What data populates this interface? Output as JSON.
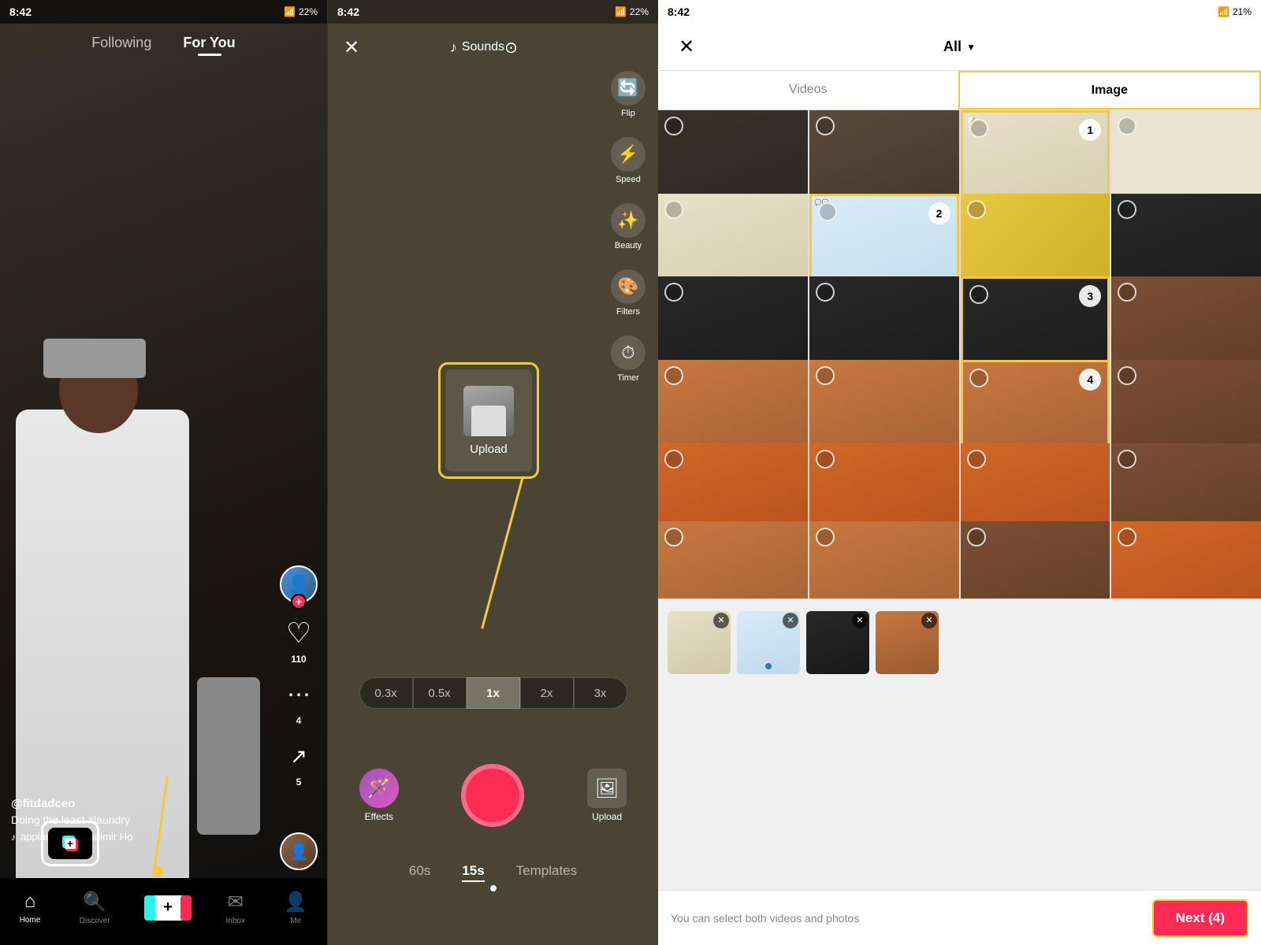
{
  "panels": {
    "feed": {
      "status_time": "8:42",
      "battery": "22%",
      "tabs": [
        "Following",
        "For You"
      ],
      "active_tab": "For You",
      "username": "@fitdadceo",
      "description": "Doing the least #laundry",
      "sound": "applause for Vladimir Ho",
      "likes": "110",
      "comments": "4",
      "shares": "5",
      "nav": {
        "items": [
          {
            "label": "Home",
            "icon": "🏠",
            "active": true
          },
          {
            "label": "Discover",
            "icon": "🔍",
            "active": false
          },
          {
            "label": "",
            "icon": "+",
            "active": false
          },
          {
            "label": "Inbox",
            "icon": "✉",
            "active": false
          },
          {
            "label": "Me",
            "icon": "👤",
            "active": false
          }
        ]
      }
    },
    "camera": {
      "status_time": "8:42",
      "battery": "22%",
      "sounds_label": "Sounds",
      "tools": [
        {
          "label": "Flip",
          "icon": "↻"
        },
        {
          "label": "Speed",
          "icon": "⏩"
        },
        {
          "label": "Beauty",
          "icon": "✨"
        },
        {
          "label": "Filters",
          "icon": "🎨"
        },
        {
          "label": "Timer",
          "icon": "⏱"
        }
      ],
      "upload_label": "Upload",
      "speed_options": [
        "0.3x",
        "0.5x",
        "1x",
        "2x",
        "3x"
      ],
      "active_speed": "1x",
      "effects_label": "Effects",
      "upload_label_bottom": "Upload",
      "timer_tabs": [
        "60s",
        "15s",
        "Templates"
      ],
      "active_timer": "15s"
    },
    "gallery": {
      "status_time": "8:42",
      "battery": "21%",
      "title": "All",
      "close_icon": "✕",
      "tabs": [
        "Videos",
        "Image"
      ],
      "active_tab": "Image",
      "selected_numbers": [
        1,
        2,
        3,
        4
      ],
      "hint_text": "You can select both videos and photos",
      "next_button": "Next (4)",
      "cells": [
        {
          "type": "person-dark",
          "selected": false,
          "number": null
        },
        {
          "type": "person-2",
          "selected": false,
          "number": null
        },
        {
          "type": "notes",
          "selected": true,
          "number": 1
        },
        {
          "type": "bright",
          "selected": false,
          "number": null
        },
        {
          "type": "notes-2",
          "selected": false,
          "number": null
        },
        {
          "type": "chat",
          "selected": true,
          "number": 2
        },
        {
          "type": "colorful",
          "selected": false,
          "number": null
        },
        {
          "type": "phone-1",
          "selected": true,
          "number": 3
        },
        {
          "type": "phone-2",
          "selected": false,
          "number": null
        },
        {
          "type": "beard-4",
          "selected": true,
          "number": 4
        },
        {
          "type": "shelf-1",
          "selected": false,
          "number": null
        },
        {
          "type": "beard-1",
          "selected": false,
          "number": null
        },
        {
          "type": "beard-2",
          "selected": false,
          "number": null
        },
        {
          "type": "beard-3",
          "selected": false,
          "number": null
        },
        {
          "type": "shelf-2",
          "selected": false,
          "number": null
        },
        {
          "type": "orange-1",
          "selected": false,
          "number": null
        },
        {
          "type": "beard-5",
          "selected": false,
          "number": null
        },
        {
          "type": "beard-6",
          "selected": false,
          "number": null
        },
        {
          "type": "shelf-3",
          "selected": false,
          "number": null
        },
        {
          "type": "orange-2",
          "selected": false,
          "number": null
        }
      ],
      "selected_thumbs": [
        {
          "type": "notes"
        },
        {
          "type": "chat"
        },
        {
          "type": "phone"
        },
        {
          "type": "beard"
        }
      ]
    }
  }
}
